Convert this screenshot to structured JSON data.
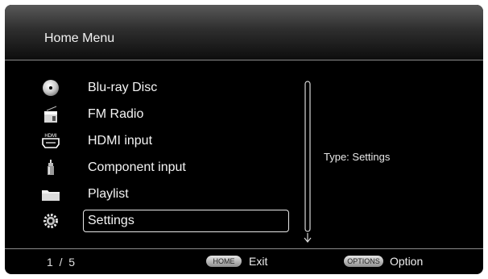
{
  "header": {
    "title": "Home Menu"
  },
  "menu": {
    "items": [
      {
        "label": "Blu-ray Disc",
        "icon": "disc-icon"
      },
      {
        "label": "FM Radio",
        "icon": "radio-icon"
      },
      {
        "label": "HDMI input",
        "icon": "hdmi-icon"
      },
      {
        "label": "Component input",
        "icon": "component-plug-icon"
      },
      {
        "label": "Playlist",
        "icon": "folder-icon"
      },
      {
        "label": "Settings",
        "icon": "gear-icon",
        "selected": true
      }
    ]
  },
  "info": {
    "text": "Type: Settings"
  },
  "hdmi_icon_text": "HDMI",
  "footer": {
    "page": "1  /  5",
    "home_key": "HOME",
    "home_label": "Exit",
    "options_key": "OPTIONS",
    "options_label": "Option"
  },
  "colors": {
    "background": "#000000",
    "text": "#f4f4f4",
    "divider": "#8a8a8a"
  }
}
